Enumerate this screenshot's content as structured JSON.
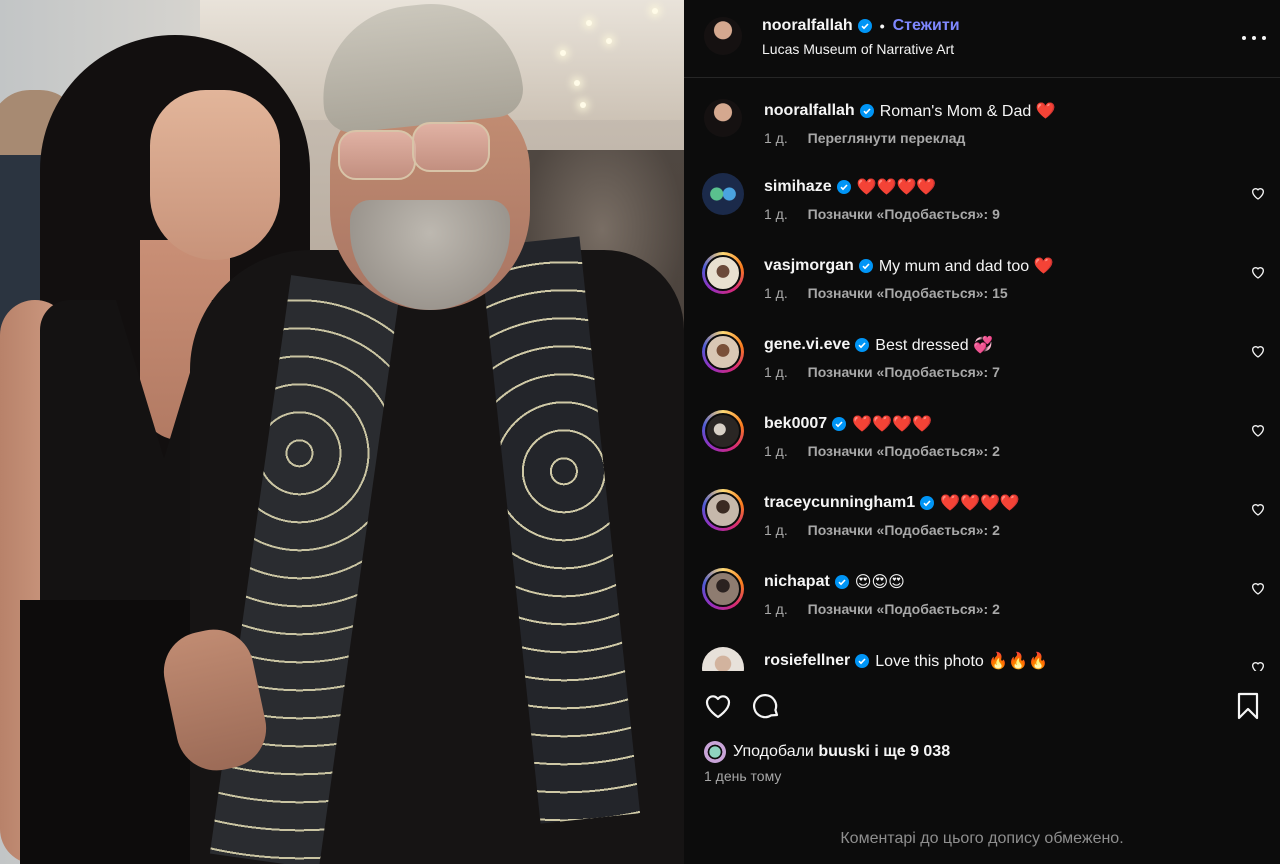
{
  "post": {
    "username": "nooralfallah",
    "dot": "•",
    "follow_label": "Стежити",
    "location": "Lucas Museum of Narrative Art"
  },
  "comments": [
    {
      "user": "nooralfallah",
      "text": "Roman's Mom & Dad ❤️",
      "time": "1 д.",
      "meta": "Переглянути переклад",
      "heart": false
    },
    {
      "user": "simihaze",
      "text": "❤️❤️❤️❤️",
      "time": "1 д.",
      "meta": "Позначки «Подобається»: 9",
      "heart": true
    },
    {
      "user": "vasjmorgan",
      "text": "My mum and dad too ❤️",
      "time": "1 д.",
      "meta": "Позначки «Подобається»: 15",
      "heart": true
    },
    {
      "user": "gene.vi.eve",
      "text": "Best dressed 💞",
      "time": "1 д.",
      "meta": "Позначки «Подобається»: 7",
      "heart": true
    },
    {
      "user": "bek0007",
      "text": "❤️❤️❤️❤️",
      "time": "1 д.",
      "meta": "Позначки «Подобається»: 2",
      "heart": true
    },
    {
      "user": "traceycunningham1",
      "text": "❤️❤️❤️❤️",
      "time": "1 д.",
      "meta": "Позначки «Подобається»: 2",
      "heart": true
    },
    {
      "user": "nichapat",
      "text": "😍😍😍",
      "time": "1 д.",
      "meta": "Позначки «Подобається»: 2",
      "heart": true
    },
    {
      "user": "rosiefellner",
      "text": "Love this photo 🔥🔥🔥",
      "time": "",
      "meta": "",
      "heart": true
    }
  ],
  "likes": {
    "prefix": "Уподобали",
    "liker": "buuski",
    "rest": "і ще 9 038"
  },
  "posted_ago": "1 день тому",
  "comments_limited": "Коментарі до цього допису обмежено.",
  "icons": [
    "verified-badge-icon",
    "more-icon",
    "heart-icon",
    "comment-icon",
    "bookmark-icon"
  ],
  "colors": {
    "accent": "#7f88ff",
    "verified": "#0095f6",
    "background": "#0c0c0c",
    "muted": "#a8a8a8"
  }
}
